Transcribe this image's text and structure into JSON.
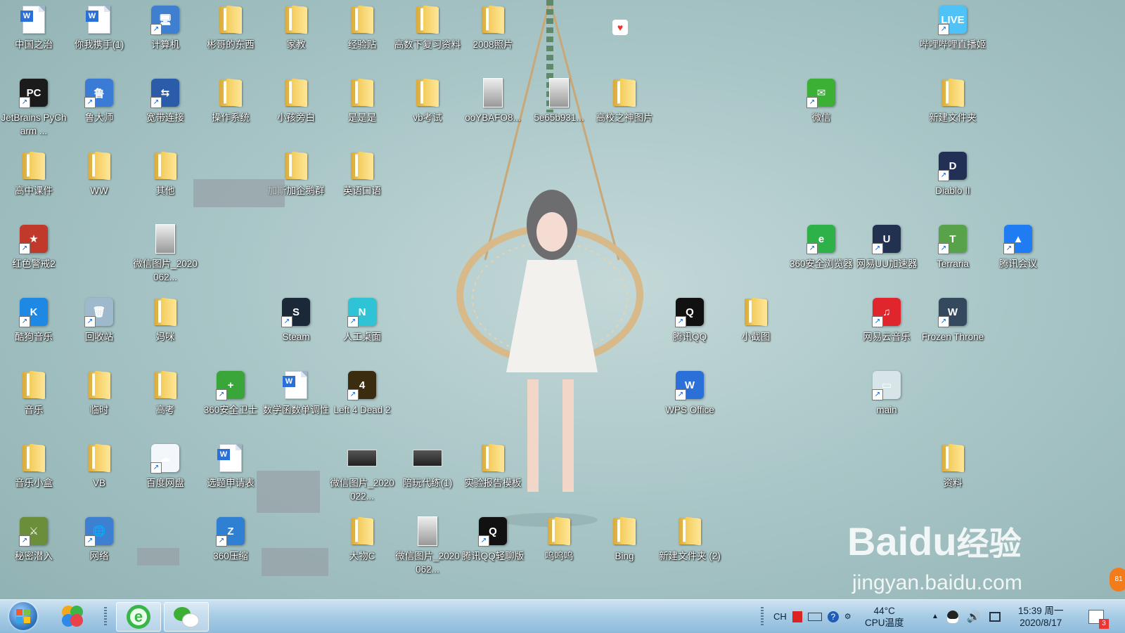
{
  "desktop": {
    "icons": [
      {
        "label": "中国之治",
        "kind": "doc"
      },
      {
        "label": "你我携手(1)",
        "kind": "doc"
      },
      {
        "label": "计算机",
        "kind": "computer"
      },
      {
        "label": "彬哥的东西",
        "kind": "folder"
      },
      {
        "label": "家教",
        "kind": "folder"
      },
      {
        "label": "经验贴",
        "kind": "folder"
      },
      {
        "label": "高数下复习资料",
        "kind": "folder"
      },
      {
        "label": "2008照片",
        "kind": "folder"
      },
      {
        "label": "哔哩哔哩直播姬",
        "kind": "app"
      },
      {
        "label": "JetBrains PyCharm ...",
        "kind": "app"
      },
      {
        "label": "鲁大师",
        "kind": "app"
      },
      {
        "label": "宽带连接",
        "kind": "app"
      },
      {
        "label": "操作系统",
        "kind": "folder"
      },
      {
        "label": "小孩旁白",
        "kind": "folder"
      },
      {
        "label": "是是是",
        "kind": "folder"
      },
      {
        "label": "vb考试",
        "kind": "folder"
      },
      {
        "label": "ooYBAFO8...",
        "kind": "photo"
      },
      {
        "label": "5e65b931...",
        "kind": "photo"
      },
      {
        "label": "高校之神图片",
        "kind": "folder"
      },
      {
        "label": "微信",
        "kind": "app"
      },
      {
        "label": "新建文件夹",
        "kind": "folder"
      },
      {
        "label": "高中课件",
        "kind": "folder"
      },
      {
        "label": "WW",
        "kind": "folder"
      },
      {
        "label": "其他",
        "kind": "folder"
      },
      {
        "label": "加斯加企鹅群",
        "kind": "folder"
      },
      {
        "label": "英语口语",
        "kind": "folder"
      },
      {
        "label": "Diablo II",
        "kind": "app"
      },
      {
        "label": "红色警戒2",
        "kind": "app"
      },
      {
        "label": "微信图片_2020062...",
        "kind": "photo"
      },
      {
        "label": "360安全浏览器",
        "kind": "app"
      },
      {
        "label": "网易UU加速器",
        "kind": "app"
      },
      {
        "label": "Terraria",
        "kind": "app"
      },
      {
        "label": "腾讯会议",
        "kind": "app"
      },
      {
        "label": "酷狗音乐",
        "kind": "app"
      },
      {
        "label": "回收站",
        "kind": "app"
      },
      {
        "label": "妈咪",
        "kind": "folder"
      },
      {
        "label": "Steam",
        "kind": "app"
      },
      {
        "label": "人工桌面",
        "kind": "app"
      },
      {
        "label": "腾讯QQ",
        "kind": "app"
      },
      {
        "label": "小截图",
        "kind": "folder"
      },
      {
        "label": "网易云音乐",
        "kind": "app"
      },
      {
        "label": "Frozen Throne",
        "kind": "app"
      },
      {
        "label": "音乐",
        "kind": "folder"
      },
      {
        "label": "临时",
        "kind": "folder"
      },
      {
        "label": "高考",
        "kind": "folder"
      },
      {
        "label": "360安全卫士",
        "kind": "app"
      },
      {
        "label": "数学函数单调性",
        "kind": "doc"
      },
      {
        "label": "Left 4 Dead 2",
        "kind": "app"
      },
      {
        "label": "WPS Office",
        "kind": "app"
      },
      {
        "label": "main",
        "kind": "app"
      },
      {
        "label": "音乐小盒",
        "kind": "folder"
      },
      {
        "label": "VB",
        "kind": "folder"
      },
      {
        "label": "百度网盘",
        "kind": "app"
      },
      {
        "label": "选题申请表",
        "kind": "doc"
      },
      {
        "label": "微信图片_2020022...",
        "kind": "photo"
      },
      {
        "label": "陪玩代练(1)",
        "kind": "photo"
      },
      {
        "label": "实验报告模板",
        "kind": "folder"
      },
      {
        "label": "资料",
        "kind": "folder"
      },
      {
        "label": "秘密潜入",
        "kind": "app"
      },
      {
        "label": "网络",
        "kind": "app"
      },
      {
        "label": "360压缩",
        "kind": "app"
      },
      {
        "label": "大物C",
        "kind": "folder"
      },
      {
        "label": "微信图片_2020062...",
        "kind": "photo"
      },
      {
        "label": "腾讯QQ轻聊版",
        "kind": "app"
      },
      {
        "label": "呜呜呜",
        "kind": "folder"
      },
      {
        "label": "Bing",
        "kind": "folder"
      },
      {
        "label": "新建文件夹 (2)",
        "kind": "folder"
      }
    ]
  },
  "taskbar": {
    "start_icon": "windows-start-icon",
    "tray": {
      "lang": "CH",
      "temp": "44°C",
      "temp_label": "CPU温度",
      "time": "15:39 周一",
      "date": "2020/8/17",
      "notify_badge": "3"
    }
  },
  "watermark": {
    "brand": "Baidu",
    "brand_cn": "经验",
    "url": "jingyan.baidu.com"
  },
  "colors": {
    "taskbar": "#a9cde6",
    "folder": "#f3cc5c",
    "wps_blue": "#2b6fd8"
  }
}
